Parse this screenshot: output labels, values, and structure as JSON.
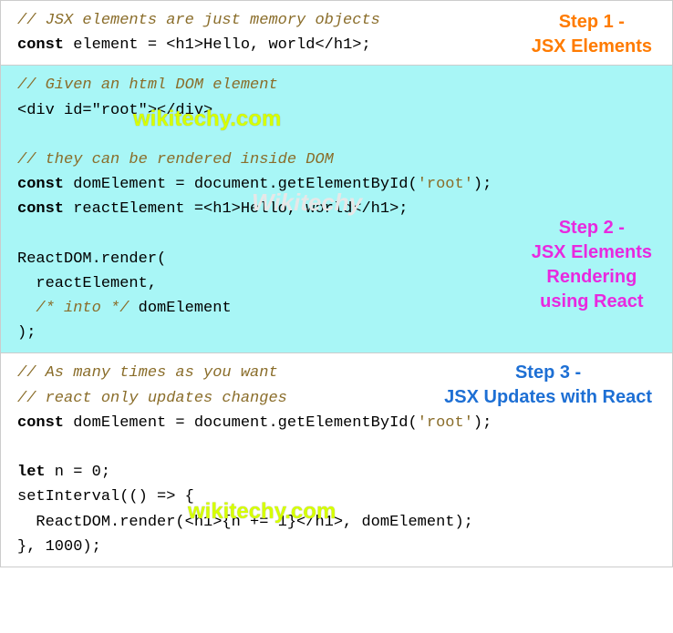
{
  "step1": {
    "label": "Step 1 -\nJSX Elements",
    "comment1": "// JSX elements are just memory objects",
    "line1_a": "const",
    "line1_b": " element = <h1>Hello, world</h1>;"
  },
  "step2": {
    "label": "Step 2 -\nJSX Elements\nRendering\nusing React",
    "comment1": "// Given an html DOM element",
    "line1": "<div id=\"root\"></div>",
    "comment2": "// they can be rendered inside DOM",
    "line2_a": "const",
    "line2_b": " domElement = document.getElementById(",
    "line2_c": "'root'",
    "line2_d": ");",
    "line3_a": "const",
    "line3_b": " reactElement =<h1>Hello, world</h1>;",
    "line4": "ReactDOM.render(",
    "line5": "  reactElement,",
    "line6a": "  ",
    "line6b": "/* into */",
    "line6c": " domElement",
    "line7": ");"
  },
  "step3": {
    "label": "Step 3 -\nJSX Updates with React",
    "comment1": "// As many times as you want",
    "comment2": "// react only updates changes",
    "line1_a": "const",
    "line1_b": " domElement = document.getElementById(",
    "line1_c": "'root'",
    "line1_d": ");",
    "line2_a": "let",
    "line2_b": " n = 0;",
    "line3": "setInterval(() => {",
    "line4": "  ReactDOM.render(<h1>{n += 1}</h1>, domElement);",
    "line5": "}, 1000);"
  },
  "watermark": {
    "text1": "wikitechy.com",
    "text2": "Wikitechy",
    "text3": "wikitechy.com"
  }
}
